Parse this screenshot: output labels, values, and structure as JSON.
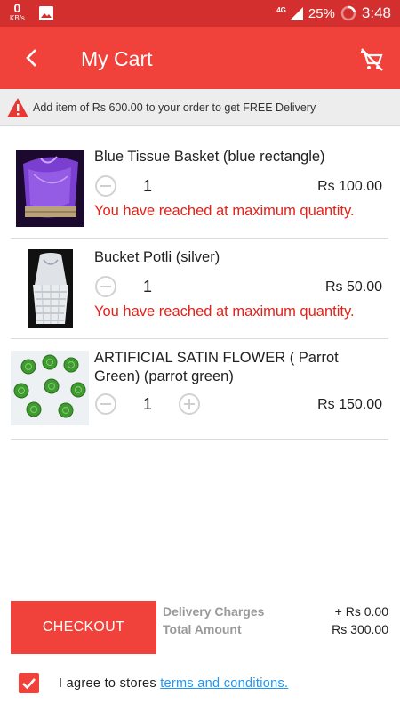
{
  "status_bar": {
    "speed_value": "0",
    "speed_unit": "KB/s",
    "network": "4G",
    "battery": "25%",
    "time": "3:48"
  },
  "app_bar": {
    "title": "My Cart",
    "back_icon": "arrow-back-icon",
    "clear_cart_icon": "remove-shopping-cart-icon"
  },
  "notice": {
    "icon": "warning-icon",
    "text": "Add item of Rs  600.00 to your order to get FREE Delivery"
  },
  "cart_items": [
    {
      "name": "Blue Tissue Basket (blue rectangle)",
      "quantity": "1",
      "price": "Rs  100.00",
      "message": "You have reached at maximum quantity."
    },
    {
      "name": "Bucket Potli (silver)",
      "quantity": "1",
      "price": "Rs  50.00",
      "message": "You have reached at maximum quantity."
    },
    {
      "name": "ARTIFICIAL SATIN FLOWER ( Parrot Green) (parrot green)",
      "quantity": "1",
      "price": "Rs  150.00",
      "message": ""
    }
  ],
  "summary": {
    "checkout_label": "CHECKOUT",
    "delivery_label": "Delivery Charges",
    "delivery_value": "+ Rs  0.00",
    "total_label": "Total Amount",
    "total_value": "Rs  300.00"
  },
  "agreement": {
    "checked": true,
    "text": "I agree to stores ",
    "link": "terms and conditions."
  },
  "colors": {
    "status_bar": "#d32f2f",
    "primary": "#f0423a",
    "error_text": "#e61f17",
    "link": "#2196f3"
  }
}
